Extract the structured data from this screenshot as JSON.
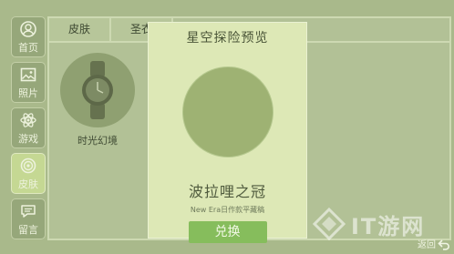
{
  "sidebar": {
    "items": [
      {
        "label": "首页",
        "icon": "user-icon"
      },
      {
        "label": "照片",
        "icon": "image-icon"
      },
      {
        "label": "游戏",
        "icon": "atom-icon"
      },
      {
        "label": "皮肤",
        "icon": "ring-icon"
      },
      {
        "label": "留言",
        "icon": "chat-icon"
      }
    ],
    "active_index": 3
  },
  "tabs": [
    "皮肤",
    "圣衣"
  ],
  "items": [
    {
      "name": "时光幻境"
    }
  ],
  "modal": {
    "title": "星空探险预览",
    "name": "波拉哩之冠",
    "subtitle": "New Era日作款平藏稿",
    "button_label": "兑换"
  },
  "watermark": "IT游网",
  "back_label": "返回",
  "colors": {
    "background": "#a9b98b",
    "modal": "#dde8b6",
    "button": "#86bd5c",
    "active_nav": "#c5d893"
  }
}
